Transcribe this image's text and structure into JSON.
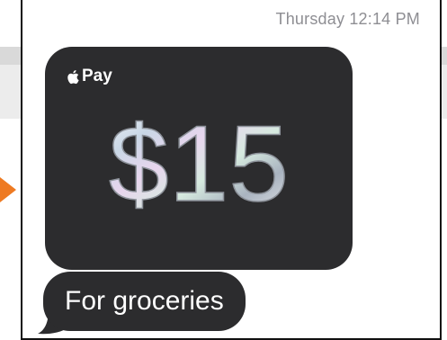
{
  "message": {
    "timestamp": "Thursday 12:14 PM",
    "payment": {
      "brand_label": "Pay",
      "amount": "$15",
      "card_color": "#2c2c2e"
    },
    "bubble_text": "For groceries"
  },
  "background": {
    "arrow_color": "#ee7a22"
  },
  "icons": {
    "brand": "apple-icon",
    "pointer": "arrow-right-icon"
  }
}
